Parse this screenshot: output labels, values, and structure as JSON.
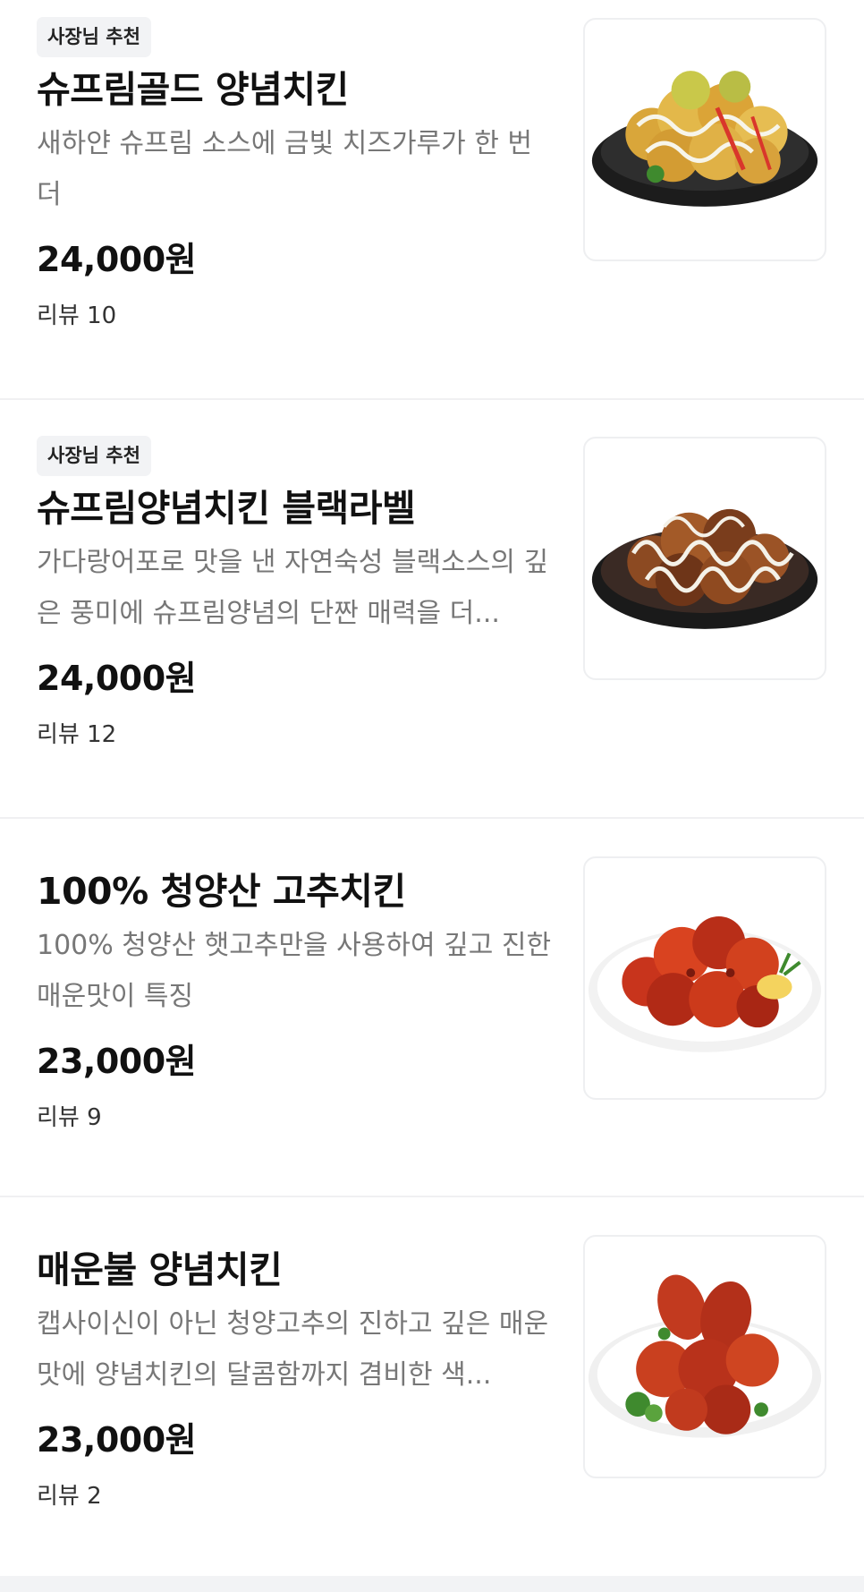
{
  "menu": {
    "items": [
      {
        "badge": "사장님 추천",
        "name": "슈프림골드 양념치킨",
        "description": "새하얀 슈프림 소스에 금빛 치즈가루가 한 번 더",
        "price": "24,000원",
        "review": "리뷰 10",
        "image_icon": "yellow-cheese-chicken-dish"
      },
      {
        "badge": "사장님 추천",
        "name": "슈프림양념치킨 블랙라벨",
        "description": "가다랑어포로 맛을 낸 자연숙성 블랙소스의 깊은 풍미에 슈프림양념의 단짠 매력을 더...",
        "price": "24,000원",
        "review": "리뷰 12",
        "image_icon": "black-sauce-chicken-dish"
      },
      {
        "badge": "",
        "name": "100% 청양산 고추치킨",
        "description": "100% 청양산 햇고추만을 사용하여 깊고 진한 매운맛이 특징",
        "price": "23,000원",
        "review": "리뷰 9",
        "image_icon": "red-pepper-chicken-dish"
      },
      {
        "badge": "",
        "name": "매운불 양념치킨",
        "description": "캡사이신이 아닌 청양고추의 진하고 깊은 매운맛에 양념치킨의 달콤함까지 겸비한 색...",
        "price": "23,000원",
        "review": "리뷰 2",
        "image_icon": "spicy-fire-chicken-dish"
      }
    ]
  }
}
